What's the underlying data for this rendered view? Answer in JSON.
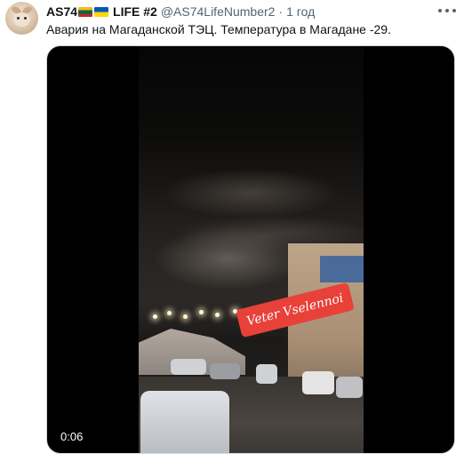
{
  "tweet": {
    "author": {
      "name_part1": "AS74",
      "flags": [
        "lithuania-flag",
        "ukraine-flag"
      ],
      "name_part2": "LIFE #2",
      "handle": "@AS74LifeNumber2",
      "separator": "·",
      "time": "1 год"
    },
    "text": "Авария на Магаданской ТЭЦ.  Температура в Магадане -29.",
    "more_icon": "more-horizontal-icon",
    "media": {
      "type": "video",
      "watermark": "Veter Vselennoi",
      "duration": "0:06"
    }
  },
  "colors": {
    "text_primary": "#0f1419",
    "text_secondary": "#536471",
    "watermark_bg": "#e8413a",
    "border": "#cfd9de"
  }
}
